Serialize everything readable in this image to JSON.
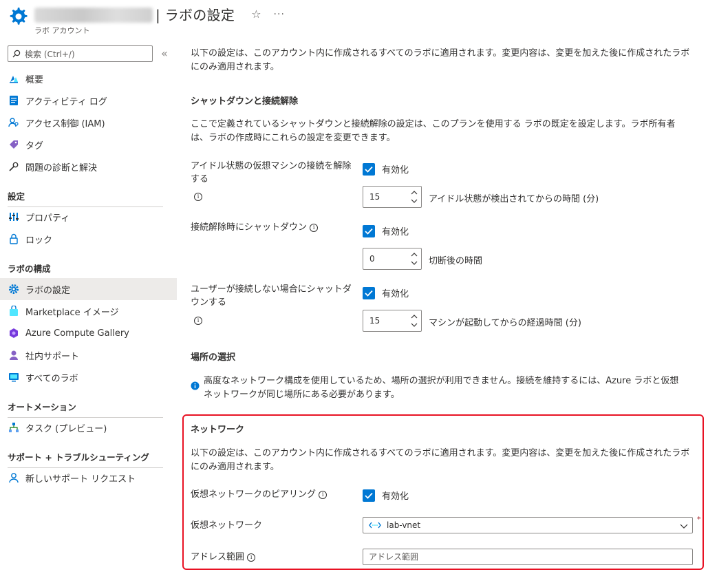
{
  "header": {
    "title": "| ラボの設定",
    "subtitle": "ラボ アカウント",
    "more": "···"
  },
  "sidebar": {
    "search_placeholder": "検索 (Ctrl+/)",
    "collapse": "«",
    "items_top": [
      {
        "label": "概要",
        "icon": "quickstart-icon"
      },
      {
        "label": "アクティビティ ログ",
        "icon": "activity-log-icon"
      },
      {
        "label": "アクセス制御 (IAM)",
        "icon": "iam-icon"
      },
      {
        "label": "タグ",
        "icon": "tag-icon"
      },
      {
        "label": "問題の診断と解決",
        "icon": "wrench-icon"
      }
    ],
    "sections": [
      {
        "title": "設定",
        "items": [
          {
            "label": "プロパティ",
            "icon": "properties-icon"
          },
          {
            "label": "ロック",
            "icon": "lock-icon"
          }
        ]
      },
      {
        "title": "ラボの構成",
        "items": [
          {
            "label": "ラボの設定",
            "icon": "gear-icon",
            "active": true
          },
          {
            "label": "Marketplace イメージ",
            "icon": "marketplace-icon"
          },
          {
            "label": "Azure Compute Gallery",
            "icon": "gallery-icon"
          },
          {
            "label": "社内サポート",
            "icon": "support-person-icon"
          },
          {
            "label": "すべてのラボ",
            "icon": "labs-icon"
          }
        ]
      },
      {
        "title": "オートメーション",
        "items": [
          {
            "label": "タスク (プレビュー)",
            "icon": "tasks-icon"
          }
        ]
      },
      {
        "title": "サポート + トラブルシューティング",
        "items": [
          {
            "label": "新しいサポート リクエスト",
            "icon": "support-request-icon"
          }
        ]
      }
    ]
  },
  "main": {
    "intro_line1": "以下の設定は、このアカウント内に作成されるすべてのラボに適用されます。変更内容は、変更を加えた後に作成されたラボ",
    "intro_line2": "にのみ適用されます。",
    "shutdown": {
      "title": "シャットダウンと接続解除",
      "desc_line1": "ここで定義されているシャットダウンと接続解除の設定は、このプランを使用する ラボの既定を設定します。ラボ所有者",
      "desc_line2": "は、ラボの作成時にこれらの設定を変更できます。",
      "idle_label_line1": "アイドル状態の仮想マシンの接続を解除",
      "idle_label_line2": "する",
      "idle_enabled": "有効化",
      "idle_value": "15",
      "idle_desc": "アイドル状態が検出されてからの時間 (分)",
      "disc_label": "接続解除時にシャットダウン",
      "disc_enabled": "有効化",
      "disc_value": "0",
      "disc_desc": "切断後の時間",
      "noconn_label_line1": "ユーザーが接続しない場合にシャットダ",
      "noconn_label_line2": "ウンする",
      "noconn_enabled": "有効化",
      "noconn_value": "15",
      "noconn_desc": "マシンが起動してからの経過時間 (分)"
    },
    "location": {
      "title": "場所の選択",
      "notice_line1": "高度なネットワーク構成を使用しているため、場所の選択が利用できません。接続を維持するには、Azure ラボと仮想",
      "notice_line2": "ネットワークが同じ場所にある必要があります。"
    },
    "network": {
      "title": "ネットワーク",
      "desc_line1": "以下の設定は、このアカウント内に作成されるすべてのラボに適用されます。変更内容は、変更を加えた後に作成されたラボ",
      "desc_line2": "にのみ適用されます。",
      "peering_label": "仮想ネットワークのピアリング",
      "peering_enabled": "有効化",
      "vnet_label": "仮想ネットワーク",
      "vnet_value": "lab-vnet",
      "required_mark": "*",
      "address_label": "アドレス範囲",
      "address_placeholder": "アドレス範囲"
    }
  },
  "colors": {
    "accent": "#0078d4",
    "highlight_border": "#e81123",
    "active_bg": "#edebe9"
  }
}
